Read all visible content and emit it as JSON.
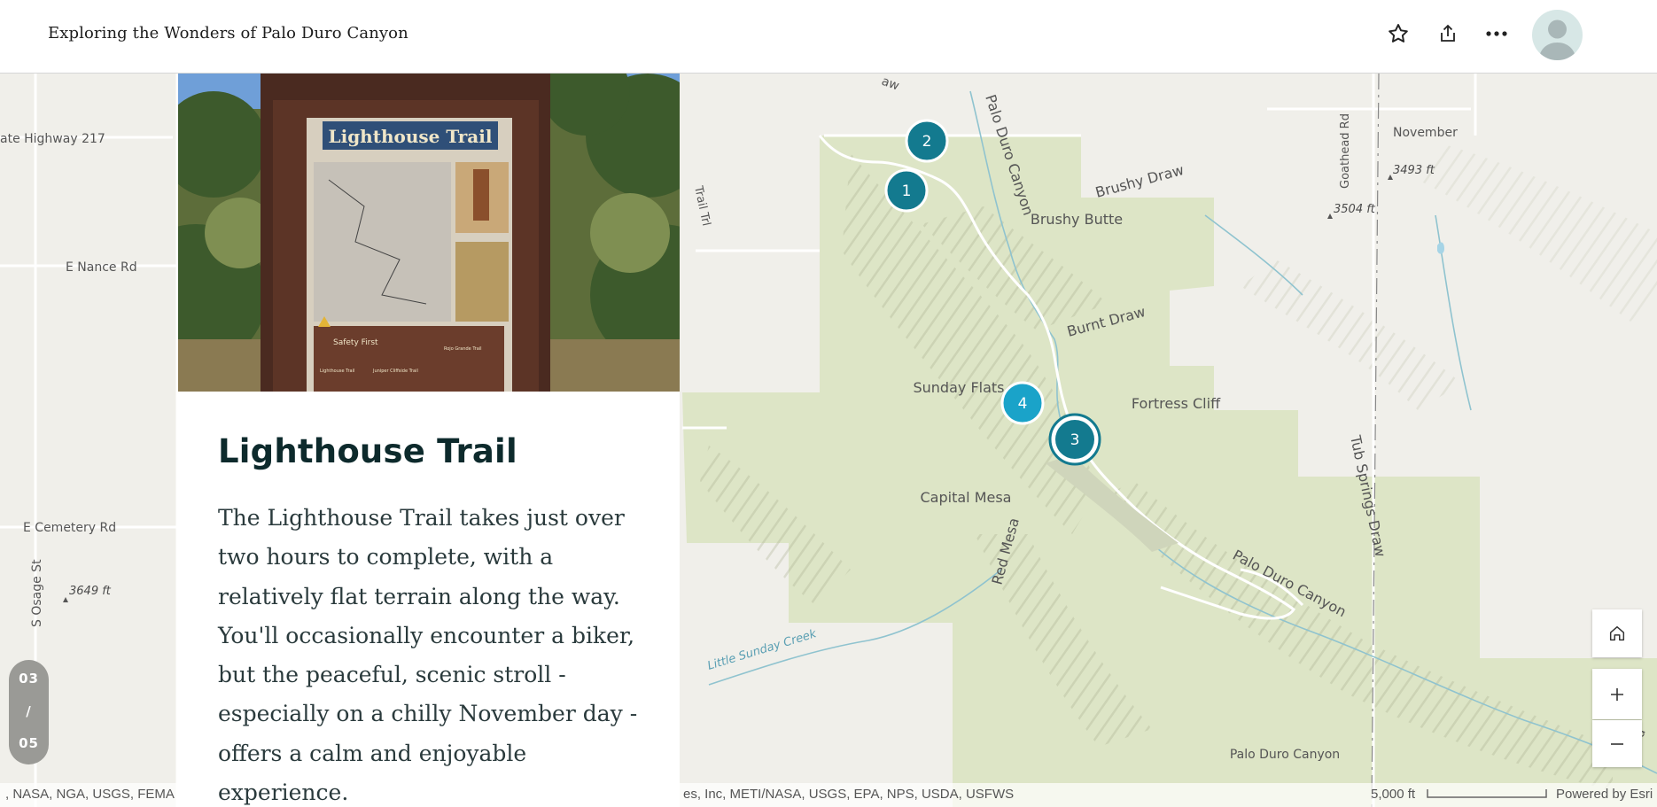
{
  "header": {
    "title": "Exploring the Wonders of Palo Duro Canyon"
  },
  "icons": {
    "favorite": "star-icon",
    "share": "share-icon",
    "more": "more-icon",
    "avatar": "user-avatar-icon",
    "home": "home-icon",
    "zoom_in": "plus-icon",
    "zoom_out": "minus-icon"
  },
  "card": {
    "title": "Lighthouse Trail",
    "body": "The Lighthouse Trail takes just over two hours to complete, with a relatively flat terrain along the way. You'll occasionally encounter a biker, but the peaceful, scenic stroll - especially on a chilly November day - offers a calm and enjoyable experience.",
    "sign_title": "Lighthouse Trail",
    "sign_safety": "Safety First",
    "sign_legend_1": "Lighthouse Trail",
    "sign_legend_2": "Juniper Cliffside Trail",
    "sign_legend_3": "Rojo Grande Trail"
  },
  "pager": {
    "current": "03",
    "separator": "/",
    "total": "05"
  },
  "map": {
    "markers": [
      "1",
      "2",
      "3",
      "4"
    ],
    "roads": [
      "ate Highway 217",
      "E Nance Rd",
      "E Cemetery Rd",
      "S Osage St",
      "Goathead Rd",
      "Trail Trl"
    ],
    "places": [
      "November",
      "Brushy Butte",
      "Sunday Flats",
      "Fortress Cliff",
      "Capital Mesa",
      "Palo Duro Canyon"
    ],
    "features": [
      "Palo Duro Canyon",
      "Brushy Draw",
      "Burnt Draw",
      "Red Mesa",
      "Tub Springs Draw",
      "Palo Duro Canyon",
      "Little Sunday Creek",
      "aw",
      "a"
    ],
    "elevations": [
      "3493 ft",
      "3504 ft",
      "3649 ft"
    ],
    "scale": "5,000 ft",
    "attribution_left": ", NASA, NGA, USGS, FEMA",
    "attribution_mid": "es, Inc, METI/NASA, USGS, EPA, NPS, USDA, USFWS",
    "powered_by": "Powered by Esri",
    "colors": {
      "marker_dark": "#137a8f",
      "marker_light": "#1aa3c9",
      "park_green": "#dde5c6"
    }
  }
}
